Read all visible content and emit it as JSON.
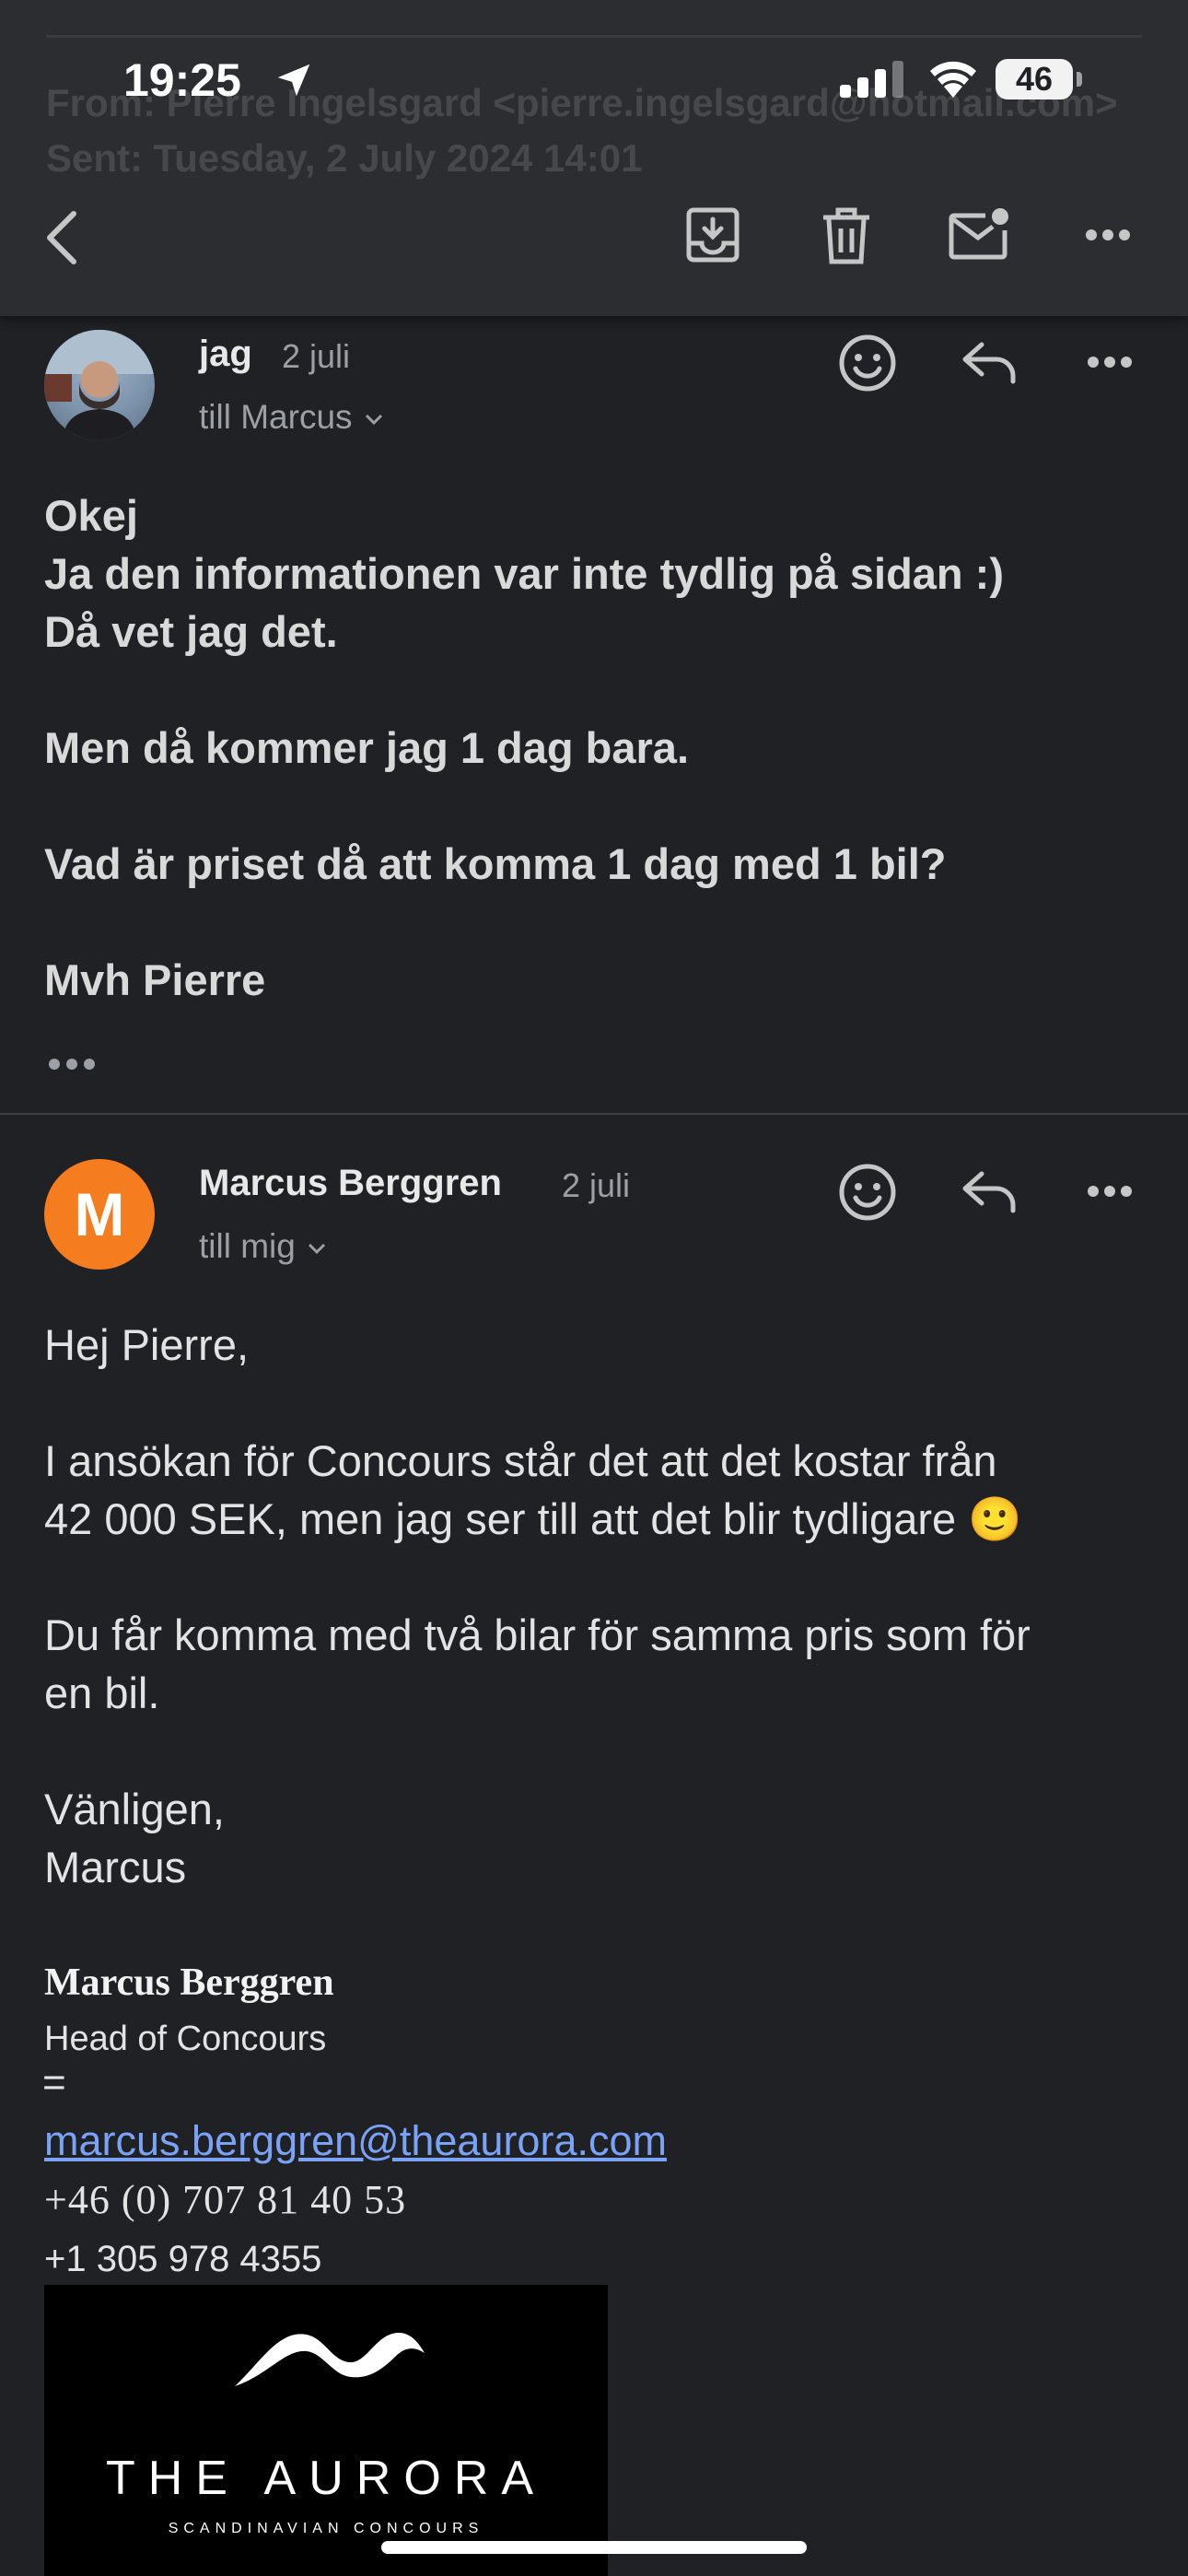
{
  "status_bar": {
    "time": "19:25",
    "battery": "46"
  },
  "background_header": {
    "from_text": "From: Pierre Ingelsgard <pierre.ingelsgard@hotmail.com>",
    "sent_text": "Sent: Tuesday, 2 July 2024 14:01"
  },
  "toolbar": {
    "back_icon": "chevron-left-icon",
    "archive_icon": "archive-icon",
    "delete_icon": "trash-icon",
    "unread_icon": "mark-unread-icon",
    "more_icon": "more-horizontal-icon"
  },
  "messages": [
    {
      "sender": "jag",
      "date": "2 juli",
      "to": "till Marcus",
      "body": "Okej\nJa den informationen var inte tydlig på sidan :)\nDå vet jag det.\n\nMen då kommer jag 1 dag bara.\n\nVad är priset då att komma 1 dag med 1 bil?\n\nMvh Pierre"
    },
    {
      "sender": "Marcus Berggren",
      "avatar_letter": "M",
      "date": "2 juli",
      "to": "till mig",
      "body": "Hej Pierre,\n\nI ansökan för Concours står det att det kostar från\n42 000 SEK, men jag ser till att det blir tydligare 🙂\n\nDu får komma med två bilar för samma pris som för\nen bil.\n\nVänligen,\nMarcus",
      "signature": {
        "name": "Marcus Berggren",
        "title": "Head of Concours",
        "separator": "=",
        "email": "marcus.berggren@theaurora.com",
        "phone1": "+46 (0) 707 81 40 53",
        "phone2": "+1 305 978 4355",
        "logo_text": "THE AURORA",
        "logo_tagline": "SCANDINAVIAN CONCOURS"
      }
    }
  ],
  "colors": {
    "background": "#202124",
    "toolbar": "#2c2d30",
    "avatar_orange": "#f57c1f",
    "link": "#7aa2f7"
  }
}
